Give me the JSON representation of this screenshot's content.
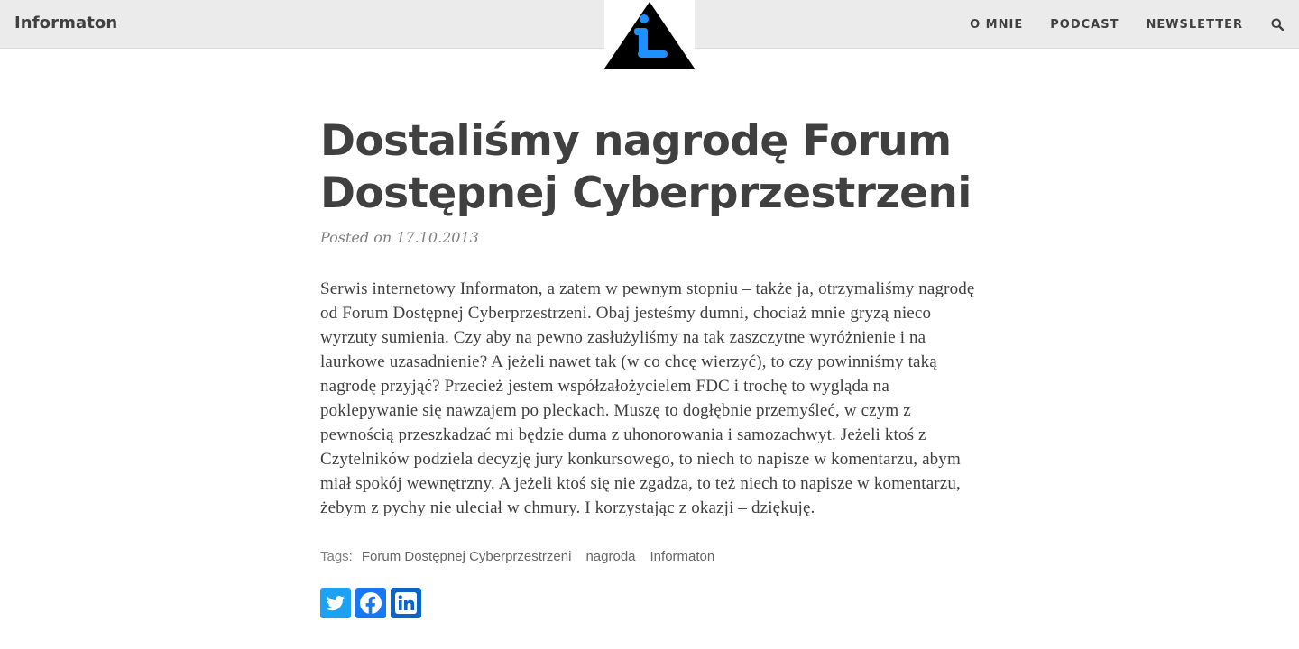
{
  "navbar": {
    "brand": "Informaton",
    "menu": [
      "O MNIE",
      "PODCAST",
      "NEWSLETTER"
    ],
    "search_icon": "search-icon"
  },
  "logo": {
    "icon": "info-triangle-icon",
    "glyph": "i",
    "accent": "#1e90ff"
  },
  "post": {
    "title": "Dostaliśmy nagrodę Forum Dostępnej Cyberprzestrzeni",
    "meta": "Posted on 17.10.2013",
    "body": "Serwis internetowy Informaton, a zatem w pewnym stopniu – także ja, otrzymaliśmy nagrodę od Forum Dostępnej Cyberprzestrzeni. Obaj jesteśmy dumni, chociaż mnie gryzą nieco wyrzuty sumienia. Czy aby na pewno zasłużyliśmy na tak zaszczytne wyróżnienie i na laurkowe uzasadnienie? A jeżeli nawet tak (w co chcę wierzyć), to czy powinniśmy taką nagrodę przyjąć? Przecież jestem współzałożycielem FDC i trochę to wygląda na poklepywanie się nawzajem po pleckach. Muszę to dogłębnie przemyśleć, w czym z pewnością przeszkadzać mi będzie duma z uhonorowania i samozachwyt. Jeżeli ktoś z Czytelników podziela decyzję jury konkursowego, to niech to napisze w komentarzu, abym miał spokój wewnętrzny. A jeżeli ktoś się nie zgadza, to też niech to napisze w komentarzu, żebym z pychy nie uleciał w chmury. I korzystając z okazji – dziękuję.",
    "tags_label": "Tags:",
    "tags": [
      "Forum Dostępnej Cyberprzestrzeni",
      "nagroda",
      "Informaton"
    ],
    "share": [
      {
        "icon": "twitter-icon",
        "color": "#1da1f2"
      },
      {
        "icon": "facebook-icon",
        "color": "#1877f2"
      },
      {
        "icon": "linkedin-icon",
        "color": "#0a66c2"
      }
    ]
  }
}
